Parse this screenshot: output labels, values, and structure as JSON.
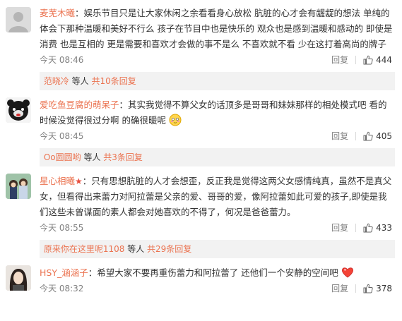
{
  "comments": [
    {
      "username": "麦芜木曦",
      "text": "：娱乐节目只是让大家休闲之余看看身心放松  肮脏的心才会有龌龊的想法  单纯的体会下那种温暖和美好不行么  孩子在节目中也是快乐的 观众也是感到温暖和感动的  即使是消费 也是互相的  更是需要和喜欢才会做的事不是么  不喜欢就不看  少在这打着高尚的牌子",
      "time": "今天 08:46",
      "reply": "回复",
      "likes": "444",
      "sub_reply": {
        "user": "范晓冷",
        "middle": " 等人 ",
        "more": "共10条回复"
      }
    },
    {
      "username": "爱吃鱼豆腐的萌呆子",
      "text": "：其实我觉得不算父女的话顶多是哥哥和妹妹那样的相处模式吧 看的时候没觉得很过分啊 的确很暖呢",
      "time": "今天 08:45",
      "reply": "回复",
      "likes": "405",
      "sub_reply": {
        "user": "Oo圆圆哟",
        "middle": " 等人 ",
        "more": "共3条回复"
      }
    },
    {
      "username": "星心相曦",
      "text": "：只有思想肮脏的人才会想歪，反正我是觉得这两父女感情纯真，虽然不是真父女，但看得出来蕾力对阿拉蕾是父亲的爱、哥哥的爱，像阿拉蕾如此可爱的孩子,即使是我们这些未曾谋面的素人都会对她喜欢的不得了，何况是爸爸蕾力。",
      "time": "今天 08:55",
      "reply": "回复",
      "likes": "433",
      "sub_reply": {
        "user": "原来你在这里呢1108",
        "middle": " 等人 ",
        "more": "共29条回复"
      }
    },
    {
      "username": "HSY_涵涵子",
      "text": "：希望大家不要再重伤蕾力和阿拉蕾了 还他们一个安静的空间吧",
      "time": "今天 08:32",
      "reply": "回复",
      "likes": "378"
    }
  ],
  "colors": {
    "link": "#eb7350",
    "text": "#333333",
    "meta": "#808080",
    "subbg": "#f2f2f2"
  },
  "icons": {
    "like": "thumbs-up-icon",
    "badge": "star-badge-icon",
    "heart": "heart-emoji",
    "smile": "blush-emoji"
  }
}
